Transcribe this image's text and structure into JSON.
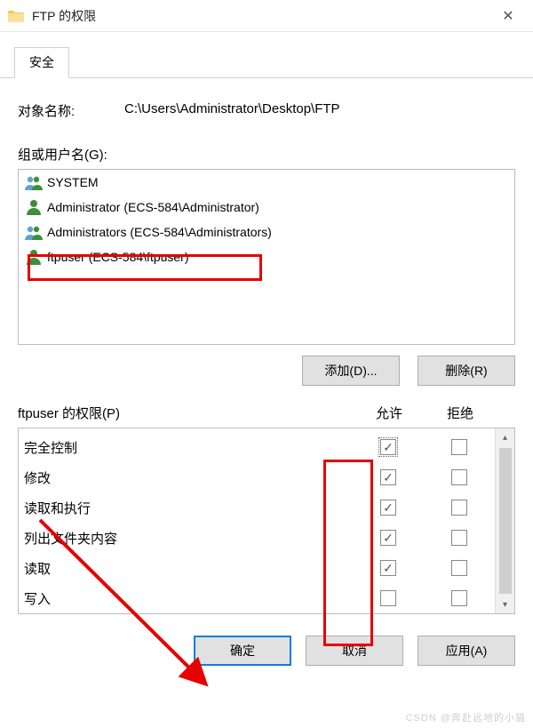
{
  "title": "FTP 的权限",
  "tab": "安全",
  "object": {
    "label": "对象名称:",
    "value": "C:\\Users\\Administrator\\Desktop\\FTP"
  },
  "groups": {
    "label": "组或用户名(G):",
    "accel": "G",
    "items": [
      {
        "name": "SYSTEM",
        "type": "group"
      },
      {
        "name": "Administrator (ECS-584\\Administrator)",
        "type": "user"
      },
      {
        "name": "Administrators (ECS-584\\Administrators)",
        "type": "group"
      },
      {
        "name": "ftpuser (ECS-584\\ftpuser)",
        "type": "user",
        "highlighted": true
      }
    ]
  },
  "buttons": {
    "add": "添加(D)...",
    "remove": "删除(R)",
    "ok": "确定",
    "cancel": "取消",
    "apply": "应用(A)"
  },
  "permissions": {
    "label_prefix": "ftpuser 的权限(P)",
    "accel": "P",
    "col_allow": "允许",
    "col_deny": "拒绝",
    "rows": [
      {
        "name": "完全控制",
        "allow": true,
        "deny": false,
        "focus": true
      },
      {
        "name": "修改",
        "allow": true,
        "deny": false
      },
      {
        "name": "读取和执行",
        "allow": true,
        "deny": false
      },
      {
        "name": "列出文件夹内容",
        "allow": true,
        "deny": false
      },
      {
        "name": "读取",
        "allow": true,
        "deny": false
      },
      {
        "name": "写入",
        "allow": false,
        "deny": false,
        "cut": true
      }
    ]
  },
  "watermark": "CSDN @奔赴远地的小猫"
}
